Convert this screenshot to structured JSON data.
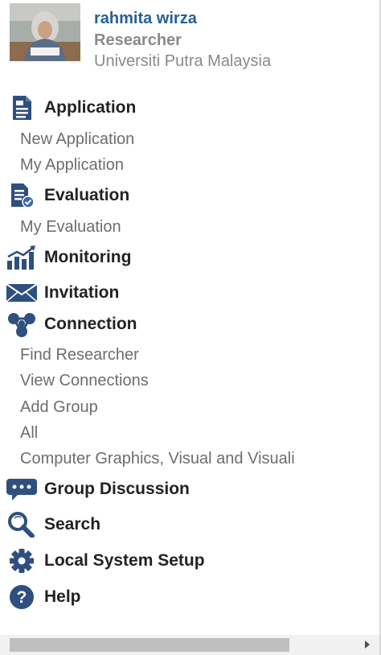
{
  "profile": {
    "name": "rahmita wirza",
    "role": "Researcher",
    "organization": "Universiti Putra Malaysia"
  },
  "nav": {
    "application": {
      "label": "Application",
      "icon": "document-icon",
      "items": [
        "New Application",
        "My Application"
      ]
    },
    "evaluation": {
      "label": "Evaluation",
      "icon": "evaluation-icon",
      "items": [
        "My Evaluation"
      ]
    },
    "monitoring": {
      "label": "Monitoring",
      "icon": "bar-chart-icon"
    },
    "invitation": {
      "label": "Invitation",
      "icon": "envelope-icon"
    },
    "connection": {
      "label": "Connection",
      "icon": "network-icon",
      "items": [
        "Find Researcher",
        "View Connections",
        "Add Group",
        "All",
        "Computer Graphics, Visual and Visuali"
      ]
    },
    "group_discussion": {
      "label": "Group Discussion",
      "icon": "chat-icon"
    },
    "search": {
      "label": "Search",
      "icon": "search-icon"
    },
    "local_setup": {
      "label": "Local System Setup",
      "icon": "gear-icon"
    },
    "help": {
      "label": "Help",
      "icon": "help-icon"
    }
  },
  "colors": {
    "icon": "#2e4f7f",
    "name": "#2a5f96",
    "muted": "#8a8a8a",
    "subitem": "#6d6d6d"
  }
}
